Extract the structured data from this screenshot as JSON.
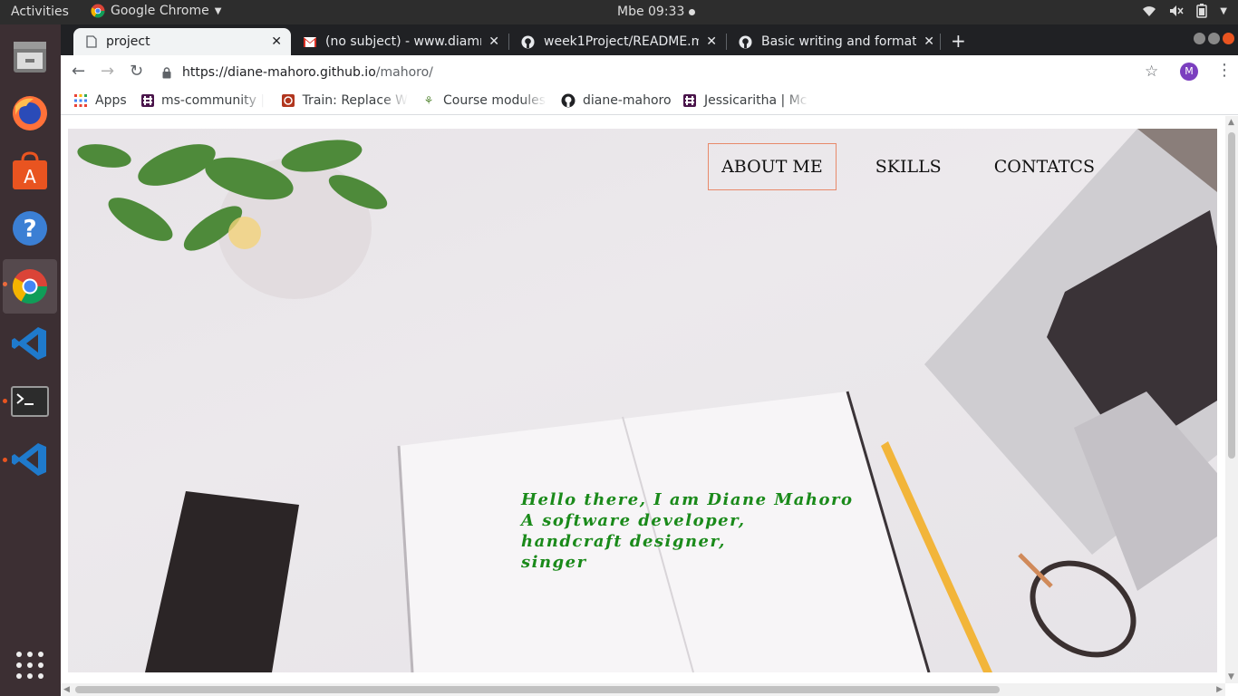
{
  "topbar": {
    "activities": "Activities",
    "app_name": "Google Chrome",
    "clock": "Mbe 09:33"
  },
  "dock": {
    "items": [
      "files-icon",
      "firefox-icon",
      "software-center-icon",
      "help-icon",
      "chrome-icon",
      "vscode-icon",
      "terminal-icon",
      "vscode-icon",
      "show-apps-icon"
    ]
  },
  "browser": {
    "tabs": [
      {
        "title": "project",
        "icon": "page-icon",
        "active": true
      },
      {
        "title": "(no subject) - www.diamn",
        "icon": "gmail-icon",
        "active": false
      },
      {
        "title": "week1Project/README.m",
        "icon": "github-icon",
        "active": false
      },
      {
        "title": "Basic writing and formatt",
        "icon": "github-icon",
        "active": false
      }
    ],
    "url_host": "https://diane-mahoro.github.io",
    "url_path": "/mahoro/",
    "profile_initial": "M",
    "bookmarks": [
      {
        "label": "Apps",
        "icon": "apps-grid-icon"
      },
      {
        "label": "ms-community |",
        "icon": "slack-icon"
      },
      {
        "label": "Train: Replace W",
        "icon": "codewars-icon"
      },
      {
        "label": "Course modules",
        "icon": "plant-icon"
      },
      {
        "label": "diane-mahoro",
        "icon": "github-icon"
      },
      {
        "label": "Jessicaritha | Mc",
        "icon": "slack-icon"
      }
    ]
  },
  "page": {
    "nav": [
      {
        "label": "ABOUT ME",
        "active": true
      },
      {
        "label": "SKILLS",
        "active": false
      },
      {
        "label": "CONTATCS",
        "active": false
      }
    ],
    "intro_lines": [
      "Hello there, I am Diane Mahoro",
      "A software developer,",
      "handcraft designer,",
      "singer"
    ],
    "intro_color": "#1a8a1a",
    "active_border_color": "#e8896a"
  }
}
